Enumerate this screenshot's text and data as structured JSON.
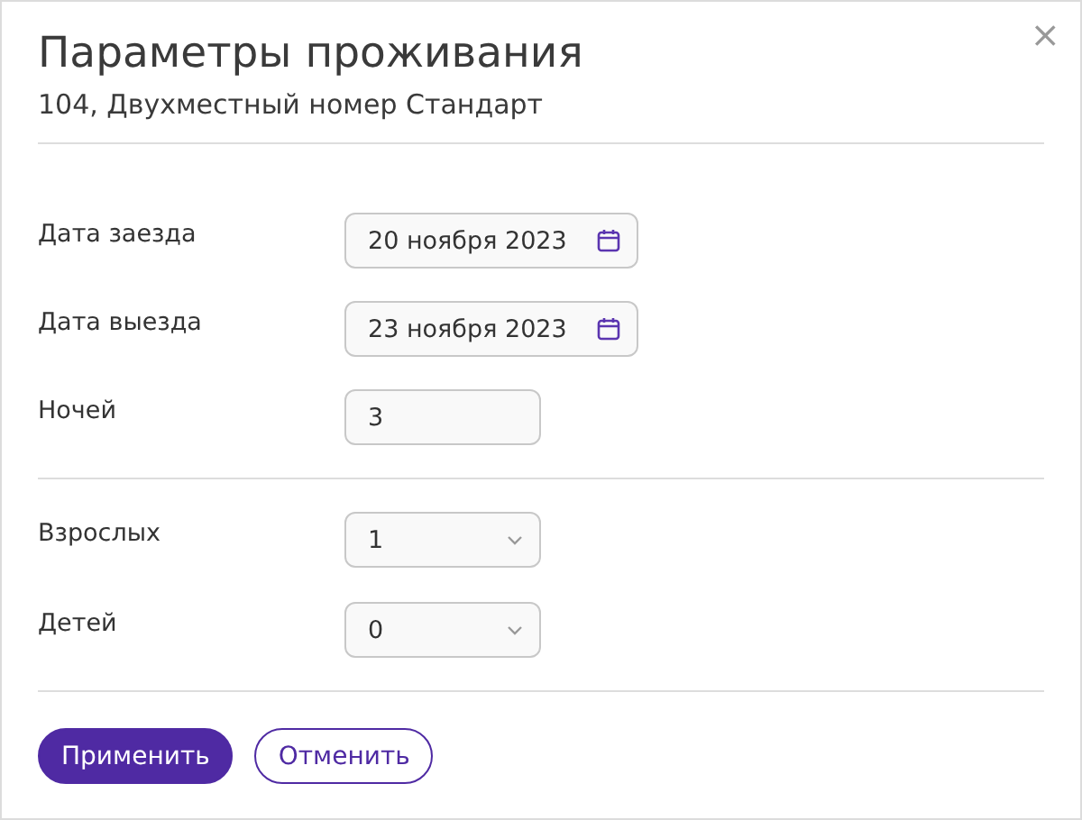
{
  "dialog": {
    "title": "Параметры проживания",
    "subtitle": "104, Двухместный номер Стандарт",
    "close": "×"
  },
  "sections": [
    {
      "fields": [
        {
          "label": "Дата заезда",
          "kind": "date",
          "value": "20 ноября 2023"
        },
        {
          "label": "Дата выезда",
          "kind": "date",
          "value": "23 ноября 2023"
        },
        {
          "label": "Ночей",
          "kind": "number",
          "value": "3"
        }
      ]
    },
    {
      "fields": [
        {
          "label": "Взрослых",
          "kind": "select",
          "value": "1"
        },
        {
          "label": "Детей",
          "kind": "select",
          "value": "0"
        }
      ]
    }
  ],
  "buttons": [
    {
      "label": "Применить",
      "kind": "primary"
    },
    {
      "label": "Отменить",
      "kind": "secondary"
    }
  ]
}
